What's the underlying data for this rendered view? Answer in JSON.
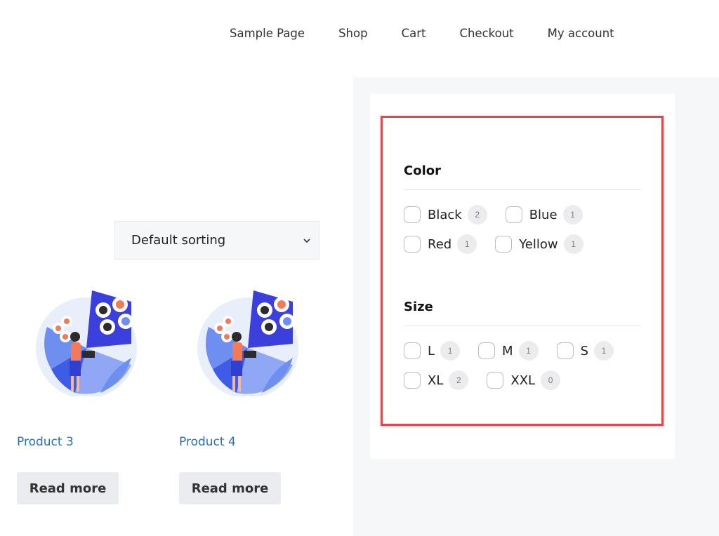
{
  "nav": {
    "items": [
      {
        "label": "Sample Page"
      },
      {
        "label": "Shop"
      },
      {
        "label": "Cart"
      },
      {
        "label": "Checkout"
      },
      {
        "label": "My account"
      }
    ]
  },
  "shop": {
    "sort_selected": "Default sorting",
    "products": [
      {
        "title": "Product 3",
        "button": "Read more"
      },
      {
        "title": "Product 4",
        "button": "Read more"
      }
    ]
  },
  "filters": {
    "color": {
      "title": "Color",
      "options": [
        {
          "label": "Black",
          "count": "2"
        },
        {
          "label": "Blue",
          "count": "1"
        },
        {
          "label": "Red",
          "count": "1"
        },
        {
          "label": "Yellow",
          "count": "1"
        }
      ]
    },
    "size": {
      "title": "Size",
      "options": [
        {
          "label": "L",
          "count": "1"
        },
        {
          "label": "M",
          "count": "1"
        },
        {
          "label": "S",
          "count": "1"
        },
        {
          "label": "XL",
          "count": "2"
        },
        {
          "label": "XXL",
          "count": "0"
        }
      ]
    }
  },
  "colors": {
    "link": "#2c6fb8",
    "highlight_border": "#e0484d",
    "button_bg": "#ebecef",
    "page_bg": "#f6f7f9"
  },
  "icons": {
    "select_arrow": "chevron-down-icon",
    "product_image": "team-analytics-illustration"
  }
}
